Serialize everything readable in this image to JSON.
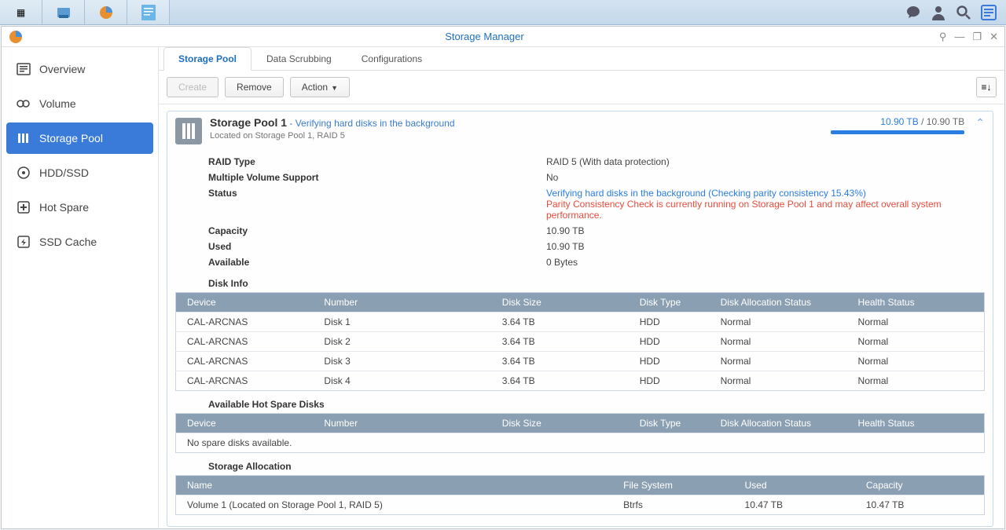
{
  "app_title": "Storage Manager",
  "sidebar": [
    {
      "icon": "overview",
      "label": "Overview"
    },
    {
      "icon": "volume",
      "label": "Volume"
    },
    {
      "icon": "pool",
      "label": "Storage Pool",
      "active": true
    },
    {
      "icon": "hdd",
      "label": "HDD/SSD"
    },
    {
      "icon": "spare",
      "label": "Hot Spare"
    },
    {
      "icon": "cache",
      "label": "SSD Cache"
    }
  ],
  "tabs": [
    {
      "label": "Storage Pool",
      "active": true
    },
    {
      "label": "Data Scrubbing"
    },
    {
      "label": "Configurations"
    }
  ],
  "toolbar": {
    "create": "Create",
    "remove": "Remove",
    "action": "Action"
  },
  "pool": {
    "title": "Storage Pool 1",
    "status_inline": "- Verifying hard disks in the background",
    "location": "Located on Storage Pool 1, RAID 5",
    "usage_used": "10.90 TB",
    "usage_sep": " / ",
    "usage_total": "10.90 TB",
    "details": {
      "raid_type_label": "RAID Type",
      "raid_type": "RAID 5 (With data protection)",
      "mvs_label": "Multiple Volume Support",
      "mvs": "No",
      "status_label": "Status",
      "status_main": "Verifying hard disks in the background",
      "status_extra": " (Checking parity consistency 15.43%)",
      "status_warn": "Parity Consistency Check is currently running on Storage Pool 1 and may affect overall system performance.",
      "capacity_label": "Capacity",
      "capacity": "10.90 TB",
      "used_label": "Used",
      "used": "10.90 TB",
      "avail_label": "Available",
      "avail": "0 Bytes"
    }
  },
  "disk_info": {
    "title": "Disk Info",
    "headers": [
      "Device",
      "Number",
      "Disk Size",
      "Disk Type",
      "Disk Allocation Status",
      "Health Status"
    ],
    "rows": [
      [
        "CAL-ARCNAS",
        "Disk 1",
        "3.64 TB",
        "HDD",
        "Normal",
        "Normal"
      ],
      [
        "CAL-ARCNAS",
        "Disk 2",
        "3.64 TB",
        "HDD",
        "Normal",
        "Normal"
      ],
      [
        "CAL-ARCNAS",
        "Disk 3",
        "3.64 TB",
        "HDD",
        "Normal",
        "Normal"
      ],
      [
        "CAL-ARCNAS",
        "Disk 4",
        "3.64 TB",
        "HDD",
        "Normal",
        "Normal"
      ]
    ]
  },
  "hot_spare": {
    "title": "Available Hot Spare Disks",
    "headers": [
      "Device",
      "Number",
      "Disk Size",
      "Disk Type",
      "Disk Allocation Status",
      "Health Status"
    ],
    "empty": "No spare disks available."
  },
  "storage_alloc": {
    "title": "Storage Allocation",
    "headers": [
      "Name",
      "File System",
      "Used",
      "Capacity"
    ],
    "rows": [
      [
        "Volume 1 (Located on Storage Pool 1, RAID 5)",
        "Btrfs",
        "10.47 TB",
        "10.47 TB"
      ]
    ]
  }
}
